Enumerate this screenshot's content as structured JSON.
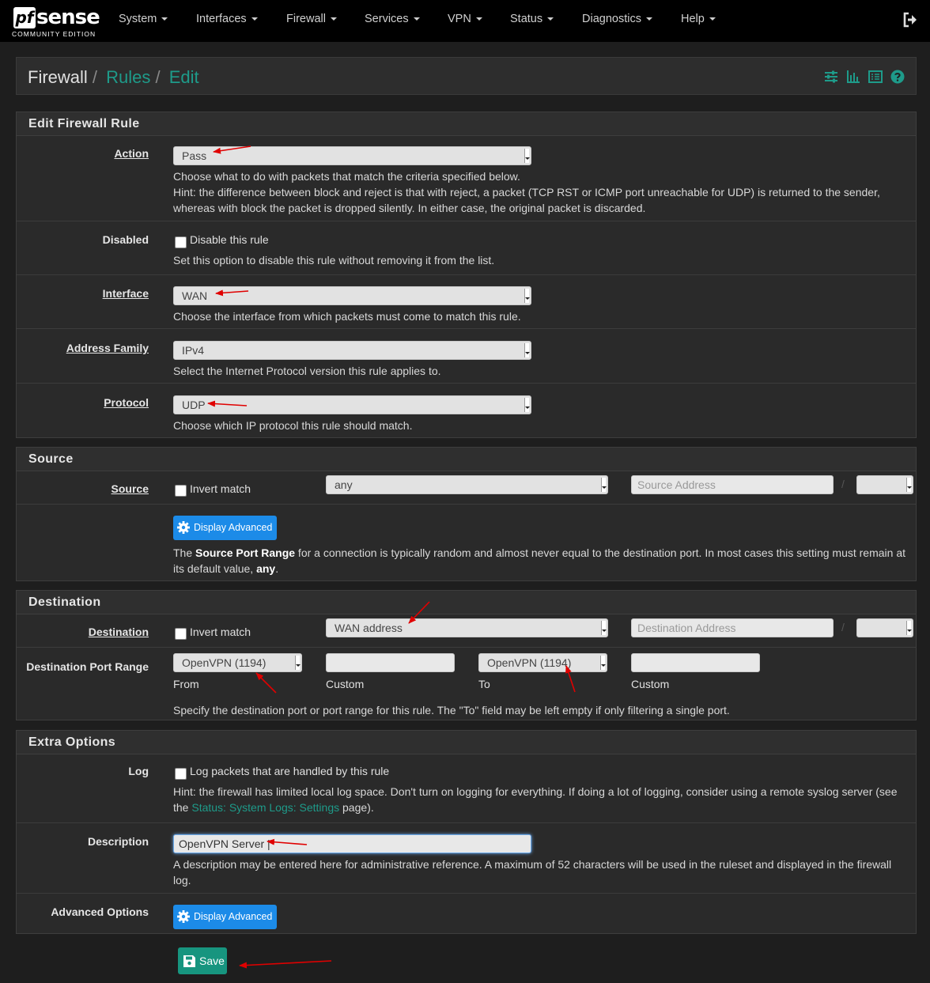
{
  "brand": {
    "pf": "pf",
    "sense": "sense",
    "edition": "COMMUNITY EDITION"
  },
  "nav": [
    "System",
    "Interfaces",
    "Firewall",
    "Services",
    "VPN",
    "Status",
    "Diagnostics",
    "Help"
  ],
  "breadcrumb": {
    "root": "Firewall",
    "rules": "Rules",
    "edit": "Edit",
    "sep": "/"
  },
  "edit_panel": {
    "title": "Edit Firewall Rule",
    "action": {
      "label": "Action",
      "value": "Pass",
      "help1": "Choose what to do with packets that match the criteria specified below.",
      "help2": "Hint: the difference between block and reject is that with reject, a packet (TCP RST or ICMP port unreachable for UDP) is returned to the sender, whereas with block the packet is dropped silently. In either case, the original packet is discarded."
    },
    "disabled": {
      "label": "Disabled",
      "checkbox": "Disable this rule",
      "help": "Set this option to disable this rule without removing it from the list."
    },
    "interface": {
      "label": "Interface",
      "value": "WAN",
      "help": "Choose the interface from which packets must come to match this rule."
    },
    "family": {
      "label": "Address Family",
      "value": "IPv4",
      "help": "Select the Internet Protocol version this rule applies to."
    },
    "protocol": {
      "label": "Protocol",
      "value": "UDP",
      "help": "Choose which IP protocol this rule should match."
    }
  },
  "source_panel": {
    "title": "Source",
    "label": "Source",
    "invert": "Invert match",
    "type": "any",
    "address_placeholder": "Source Address",
    "slash": "/",
    "adv_button": "Display Advanced",
    "help_pre": "The ",
    "help_bold": "Source Port Range",
    "help_mid": " for a connection is typically random and almost never equal to the destination port. In most cases this setting must remain at its default value, ",
    "help_any": "any",
    "help_end": "."
  },
  "dest_panel": {
    "title": "Destination",
    "label": "Destination",
    "invert": "Invert match",
    "type": "WAN address",
    "address_placeholder": "Destination Address",
    "slash": "/",
    "port_label": "Destination Port Range",
    "from_value": "OpenVPN (1194)",
    "from_label": "From",
    "custom_label": "Custom",
    "to_value": "OpenVPN (1194)",
    "to_label": "To",
    "help": "Specify the destination port or port range for this rule. The \"To\" field may be left empty if only filtering a single port."
  },
  "extra_panel": {
    "title": "Extra Options",
    "log": {
      "label": "Log",
      "checkbox": "Log packets that are handled by this rule",
      "help_pre": "Hint: the firewall has limited local log space. Don't turn on logging for everything. If doing a lot of logging, consider using a remote syslog server (see the ",
      "help_link": "Status: System Logs: Settings",
      "help_end": " page)."
    },
    "description": {
      "label": "Description",
      "value": "OpenVPN Server",
      "help": "A description may be entered here for administrative reference. A maximum of 52 characters will be used in the ruleset and displayed in the firewall log."
    },
    "advanced": {
      "label": "Advanced Options",
      "button": "Display Advanced"
    }
  },
  "save": "Save",
  "colors": {
    "accent": "#1e9b8a",
    "save": "#17957f",
    "advanced": "#1c8be8",
    "annotation": "#e00000"
  }
}
